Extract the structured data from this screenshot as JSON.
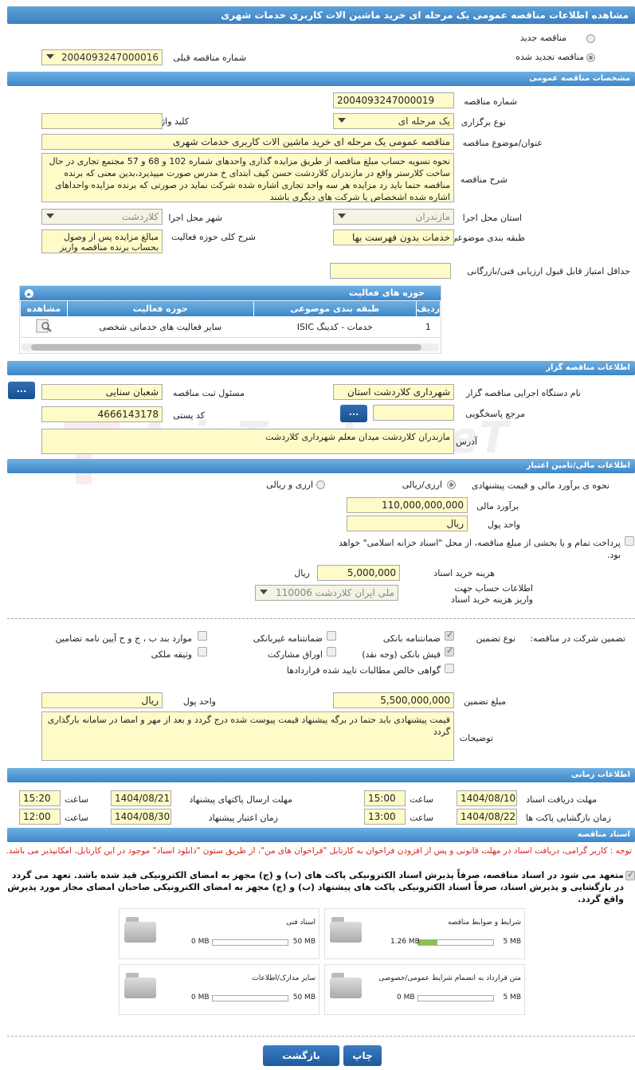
{
  "title": "مشاهده اطلاعات مناقصه عمومی یک مرحله ای خرید ماشین الات کاربری خدمات شهری",
  "top": {
    "new_label": "مناقصه جدید",
    "renewed_label": "مناقصه تجدید شده",
    "prev_label": "شماره مناقصه قبلی",
    "prev_value": "2004093247000016"
  },
  "general": {
    "header": "مشخصات مناقصه عمومی",
    "number_label": "شماره مناقصه",
    "number": "2004093247000019",
    "type_label": "نوع برگزاری",
    "type": "یک مرحله ای",
    "keyword_label": "کلید واژه",
    "keyword": "",
    "subject_label": "عنوان/موضوع مناقصه",
    "subject": "مناقصه عمومی یک مرحله ای خرید ماشین الات کاربری خدمات شهری",
    "desc_label": "شرح مناقصه",
    "desc": "نحوه تسویه حساب مبلغ مناقصه از طریق مزایده گذاری واحدهای شماره 102 و 68 و 57 مجتمع تجاری در حال ساخت کلارستر واقع در مازندران کلاردشت حسن کیف ابتدای خ مدرس صورت میپذیرد،بدین معنی که برنده مناقصه حتما باید رد مزایده هر سه واحد تجاری اشاره شده شرکت نماید در صورتی که برنده مزایده واحداهای اشاره شده اشخصاص یا شرکت های دیگری باشند",
    "province_label": "استان محل اجرا",
    "province": "مازندران",
    "city_label": "شهر محل اجرا",
    "city": "کلاردشت",
    "category_label": "طبقه بندی موضوعی",
    "category": "خدمات بدون فهرست بها",
    "scope_label": "شرح کلی حوزه فعالیت",
    "scope": "مبالغ مزایده پس از وصول بحساب برنده مناقصه واریز",
    "min_score_label": "حداقل امتیاز قابل قبول ارزیابی فنی/بازرگانی",
    "min_score": ""
  },
  "activities": {
    "header": "حوزه های فعالیت",
    "cols": [
      "ردیف",
      "طبقه بندی موضوعی",
      "حوزه فعالیت",
      "مشاهده"
    ],
    "rows": [
      {
        "idx": "1",
        "cat": "خدمات - کدینگ ISIC",
        "area": "سایر فعالیت های خدماتی شخصی"
      }
    ]
  },
  "organizer": {
    "header": "اطلاعات مناقصه گزار",
    "org_label": "نام دستگاه اجرایی مناقصه گزار",
    "org": "شهرداری کلاردشت استان",
    "resp_label": "مسئول ثبت مناقصه",
    "resp": "شعبان سنایی",
    "ref_label": "مرجع پاسخگویی",
    "ref": "",
    "postal_label": "کد پستی",
    "postal": "4666143178",
    "addr_label": "آدرس",
    "addr": "مازندران کلاردشت میدان معلم شهرداری کلاردشت",
    "btn": "..."
  },
  "finance": {
    "header": "اطلاعات مالی/تامین اعتبار",
    "method_label": "نحوه ی برآورد مالی و قیمت پیشنهادی",
    "opt1": "ارزی/ریالی",
    "opt2": "ارزی و ریالی",
    "est_label": "برآورد مالی",
    "est": "110,000,000,000",
    "unit_label": "واحد پول",
    "unit": "ریال",
    "partial": "پرداخت تمام و یا بخشی از مبلغ مناقصه، از محل \"اسناد خزانه اسلامی\" خواهد بود.",
    "cost_label": "هزینه خرید اسناد",
    "cost": "5,000,000",
    "cost_unit": "ریال",
    "acct_label": "اطلاعات حساب جهت واریز هزینه خرید اسناد",
    "acct": "ملی ایران کلاردشت 110006"
  },
  "guarantee": {
    "label": "تضمین شرکت در مناقصه:",
    "type_label": "نوع تضمین",
    "items": [
      "ضمانتنامه بانکی",
      "ضمانتنامه غیربانکی",
      "موارد بند ب ، ج و ح آیین نامه تضامین",
      "فیش بانکی (وجه نقد)",
      "اوراق مشارکت",
      "وثیقه ملکی",
      "گواهی خالص مطالبات تایید شده قراردادها"
    ],
    "amount_label": "مبلغ تضمین",
    "amount": "5,500,000,000",
    "unit_label": "واحد پول",
    "unit": "ریال",
    "notes_label": "توضیحات",
    "notes": "قیمت پیشنهادی باید حتما در برگه پیشنهاد قیمت پیوست شده درج گردد و بعد از مهر و امضا در سامانه بارگذاری گردد"
  },
  "timing": {
    "header": "اطلاعات زمانی",
    "dl_label": "مهلت دریافت اسناد",
    "dl_date": "1404/08/10",
    "send_label": "مهلت ارسال پاکتهای پیشنهاد",
    "send_date": "1404/08/21",
    "open_label": "زمان بازگشایی پاکت ها",
    "open_date": "1404/08/22",
    "valid_label": "زمان اعتبار پیشنهاد",
    "valid_date": "1404/08/30",
    "time_label": "ساعت",
    "dl_time": "15:00",
    "send_time": "15:20",
    "open_time": "13:00",
    "valid_time": "12:00"
  },
  "docs": {
    "header": "اسناد مناقصه",
    "notice": "توجه : کاربر گرامی، دریافت اسناد در مهلت قانونی و پس از افزودن فراخوان به کارتابل \"فراخوان های من\"، از طریق ستون \"دانلود اسناد\" موجود در این کارتابل، امکانپذیر می باشد.",
    "commit": "متعهد می شود در اسناد مناقصه، صرفاً پذیرش اسناد الکترونیکی پاکت های (ب) و (ج) مجهز به امضای الکترونیکی قید شده باشد. تعهد می گردد در بازگشایی و پذیرش اسناد، صرفاً اسناد الکترونیکی پاکت های پیشنهاد (ب) و (ج) مجهز به امضای الکترونیکی صاحبان امضای مجاز مورد پذیرش واقع گردد.",
    "files": [
      {
        "name": "شرایط و ضوابط مناقصه",
        "size": "1.26 MB",
        "max": "5 MB",
        "fill": 0.25
      },
      {
        "name": "اسناد فنی",
        "size": "0 MB",
        "max": "50 MB",
        "fill": 0
      },
      {
        "name": "متن قرارداد به انضمام شرایط عمومی/خصوصی",
        "size": "0 MB",
        "max": "5 MB",
        "fill": 0
      },
      {
        "name": "سایر مدارک/اطلاعات",
        "size": "0 MB",
        "max": "50 MB",
        "fill": 0
      }
    ]
  },
  "footer": {
    "print": "چاپ",
    "back": "بازگشت"
  },
  "watermark": "AriaTender.neT"
}
